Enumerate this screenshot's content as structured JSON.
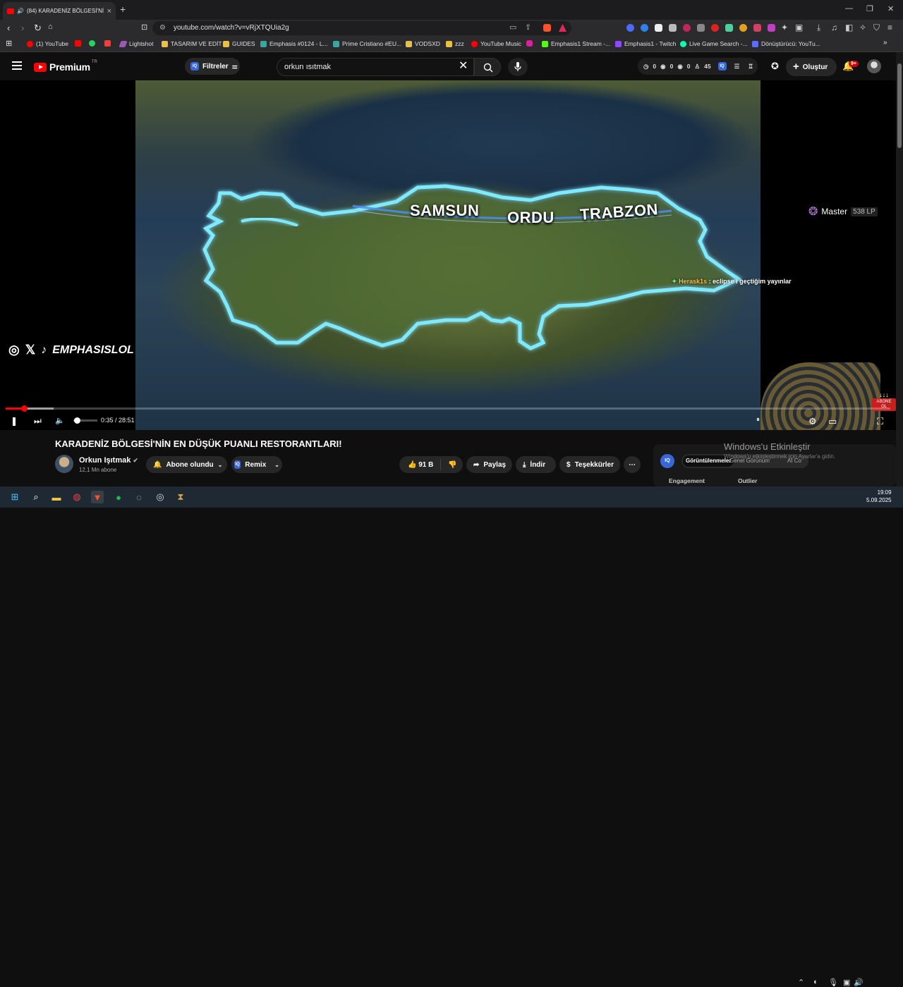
{
  "browser": {
    "tab_title": "(84) KARADENİZ BÖLGESİ'Nİ",
    "url": "youtube.com/watch?v=vRjXTQUia2g",
    "new_tab": "+",
    "bookmarks": [
      "(1) YouTube",
      "Lightshot",
      "TASARIM VE EDİT",
      "GUIDES",
      "Emphasis #0124 - L...",
      "Prime Cristiano #EU...",
      "VODSXD",
      "zzz",
      "YouTube Music",
      "Emphasis1 Stream -...",
      "Emphasis1 - Twitch",
      "Live Game Search -...",
      "Dönüştürücü: YouTu..."
    ]
  },
  "youtube": {
    "logo": "Premium",
    "logo_region": "TR",
    "filters_label": "Filtreler",
    "search_value": "orkun ısıtmak",
    "stats": [
      "0",
      "0",
      "0",
      "45"
    ],
    "create_label": "Oluştur",
    "notifications": "9+"
  },
  "video": {
    "cities": [
      "SAMSUN",
      "ORDU",
      "TRABZON"
    ],
    "watermark": "EMPHASISLOL",
    "chat_user": "Herask1s",
    "chat_message": ": eclipse i geçtiğim yayınlar",
    "rank": "Master",
    "rank_lp": "538 LP",
    "abone_label": "ABONE OL",
    "time": "0:35 / 28:51",
    "progress": 0.0204,
    "volume": 0.05
  },
  "meta": {
    "title": "KARADENİZ BÖLGESİ'NİN EN DÜŞÜK PUANLI RESTORANTLARI!",
    "channel": "Orkun Işıtmak",
    "subscribers": "12,1 Mn abone",
    "subscribed_label": "Abone olundu",
    "remix_label": "Remix",
    "likes": "91 B",
    "share_label": "Paylaş",
    "download_label": "İndir",
    "thanks_label": "Teşekkürler"
  },
  "panel": {
    "tab_active": "Görüntülenmeler",
    "tab_2": "Genel Görünüm",
    "tab_3": "AI Co",
    "col_1": "Engagement",
    "col_2": "Outlier",
    "win_activate": "Windows'u Etkinleştir",
    "win_activate_sub": "Windows'u etkinleştirmek için Ayarlar'a gidin."
  },
  "taskbar": {
    "time": "19:09",
    "date": "5.09.2025"
  },
  "colors": {
    "yt_red": "#ff0000",
    "outline_glow": "#7fe9ff",
    "accent_blue": "#3867d6"
  }
}
